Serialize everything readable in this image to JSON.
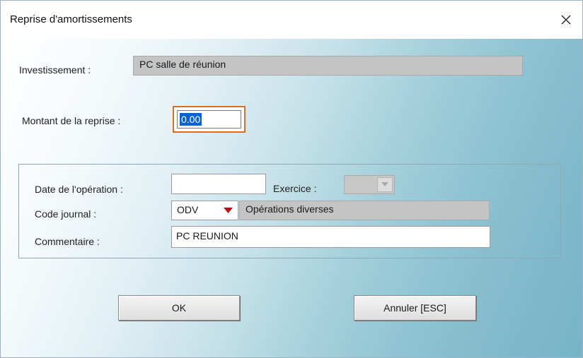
{
  "window": {
    "title": "Reprise d'amortissements",
    "close_icon": "close-icon"
  },
  "investissement": {
    "label": "Investissement :",
    "value": "PC salle de réunion"
  },
  "montant": {
    "label": "Montant de la reprise :",
    "value": "0.00"
  },
  "operation": {
    "date_label": "Date de l'opération :",
    "date_value": "",
    "exercice_label": "Exercice :",
    "exercice_value": "",
    "journal_label": "Code journal :",
    "journal_code": "ODV",
    "journal_name": "Opérations diverses",
    "commentaire_label": "Commentaire :",
    "commentaire_value": "PC REUNION"
  },
  "buttons": {
    "ok": "OK",
    "cancel": "Annuler [ESC]"
  },
  "colors": {
    "focus_border": "#e06d1f",
    "selection": "#0a63cc",
    "dropdown_arrow": "#b3101a",
    "gradient_end": "#78b4c6"
  }
}
